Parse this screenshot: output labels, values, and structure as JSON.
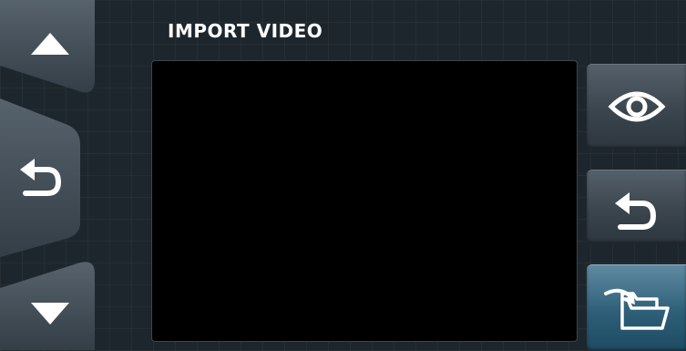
{
  "screen": {
    "title": "IMPORT VIDEO"
  },
  "left_panel": {
    "buttons": [
      {
        "name": "scroll-up-button",
        "icon": "triangle-up-icon"
      },
      {
        "name": "back-button",
        "icon": "undo-arrow-icon"
      },
      {
        "name": "scroll-down-button",
        "icon": "triangle-down-icon"
      }
    ]
  },
  "right_panel": {
    "buttons": [
      {
        "name": "preview-button",
        "icon": "eye-icon",
        "state": "normal"
      },
      {
        "name": "undo-button",
        "icon": "undo-arrow-icon",
        "state": "normal"
      },
      {
        "name": "import-folder-button",
        "icon": "folder-import-icon",
        "state": "active"
      }
    ]
  },
  "colors": {
    "background": "#1e262d",
    "button_gray": "#3b454e",
    "button_active": "#2e5f78",
    "video_area": "#000000",
    "text": "#ffffff"
  }
}
